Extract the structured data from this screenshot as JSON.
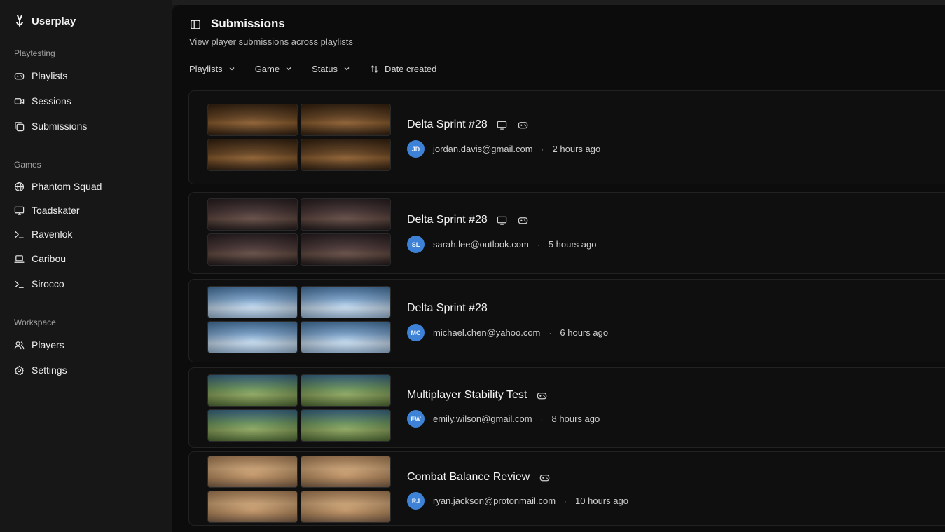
{
  "app": {
    "name": "Userplay"
  },
  "sidebar": {
    "sections": {
      "playtesting": "Playtesting",
      "games": "Games",
      "workspace": "Workspace"
    },
    "playtesting_items": [
      {
        "label": "Playlists",
        "icon": "gamepad-icon"
      },
      {
        "label": "Sessions",
        "icon": "video-icon"
      },
      {
        "label": "Submissions",
        "icon": "stack-icon"
      }
    ],
    "games_items": [
      {
        "label": "Phantom Squad",
        "icon": "globe-icon"
      },
      {
        "label": "Toadskater",
        "icon": "monitor-icon"
      },
      {
        "label": "Ravenlok",
        "icon": "terminal-icon"
      },
      {
        "label": "Caribou",
        "icon": "laptop-icon"
      },
      {
        "label": "Sirocco",
        "icon": "terminal-icon"
      }
    ],
    "workspace_items": [
      {
        "label": "Players",
        "icon": "users-icon"
      },
      {
        "label": "Settings",
        "icon": "gear-icon"
      }
    ]
  },
  "header": {
    "title": "Submissions",
    "subtitle": "View player submissions across playlists"
  },
  "filters": {
    "playlists": "Playlists",
    "game": "Game",
    "status": "Status",
    "sort": "Date created"
  },
  "submissions": [
    {
      "title": "Delta Sprint #28",
      "initials": "JD",
      "email": "jordan.davis@gmail.com",
      "time": "2 hours ago",
      "devices": [
        "monitor-icon",
        "gamepad-icon"
      ],
      "theme": "amber"
    },
    {
      "title": "Delta Sprint #28",
      "initials": "SL",
      "email": "sarah.lee@outlook.com",
      "time": "5 hours ago",
      "devices": [
        "monitor-icon",
        "gamepad-icon"
      ],
      "theme": "dark"
    },
    {
      "title": "Delta Sprint #28",
      "initials": "MC",
      "email": "michael.chen@yahoo.com",
      "time": "6 hours ago",
      "devices": [],
      "theme": "snow"
    },
    {
      "title": "Multiplayer Stability Test",
      "initials": "EW",
      "email": "emily.wilson@gmail.com",
      "time": "8 hours ago",
      "devices": [
        "gamepad-icon"
      ],
      "theme": "field"
    },
    {
      "title": "Combat Balance Review",
      "initials": "RJ",
      "email": "ryan.jackson@protonmail.com",
      "time": "10 hours ago",
      "devices": [
        "gamepad-icon"
      ],
      "theme": "desert"
    }
  ],
  "colors": {
    "sidebar_bg": "#171717",
    "main_bg": "#0c0c0c",
    "avatar_blue": "#3d82d6"
  }
}
